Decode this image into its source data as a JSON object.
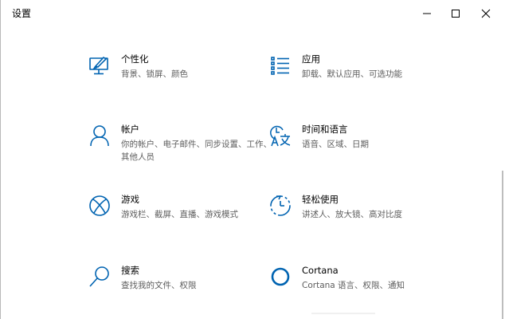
{
  "window": {
    "title": "设置",
    "accent": "#0063b1"
  },
  "items": [
    {
      "id": "personalization",
      "label": "个性化",
      "desc": "背景、锁屏、颜色",
      "icon": "personalization-icon"
    },
    {
      "id": "apps",
      "label": "应用",
      "desc": "卸载、默认应用、可选功能",
      "icon": "apps-list-icon"
    },
    {
      "id": "accounts",
      "label": "帐户",
      "desc": "你的帐户、电子邮件、同步设置、工作、其他人员",
      "icon": "person-icon"
    },
    {
      "id": "time",
      "label": "时间和语言",
      "desc": "语音、区域、日期",
      "icon": "time-language-icon"
    },
    {
      "id": "gaming",
      "label": "游戏",
      "desc": "游戏栏、截屏、直播、游戏模式",
      "icon": "xbox-icon"
    },
    {
      "id": "ease",
      "label": "轻松使用",
      "desc": "讲述人、放大镜、高对比度",
      "icon": "ease-of-access-icon"
    },
    {
      "id": "search",
      "label": "搜索",
      "desc": "查找我的文件、权限",
      "icon": "search-icon"
    },
    {
      "id": "cortana",
      "label": "Cortana",
      "desc": "Cortana 语言、权限、通知",
      "icon": "cortana-icon"
    }
  ]
}
